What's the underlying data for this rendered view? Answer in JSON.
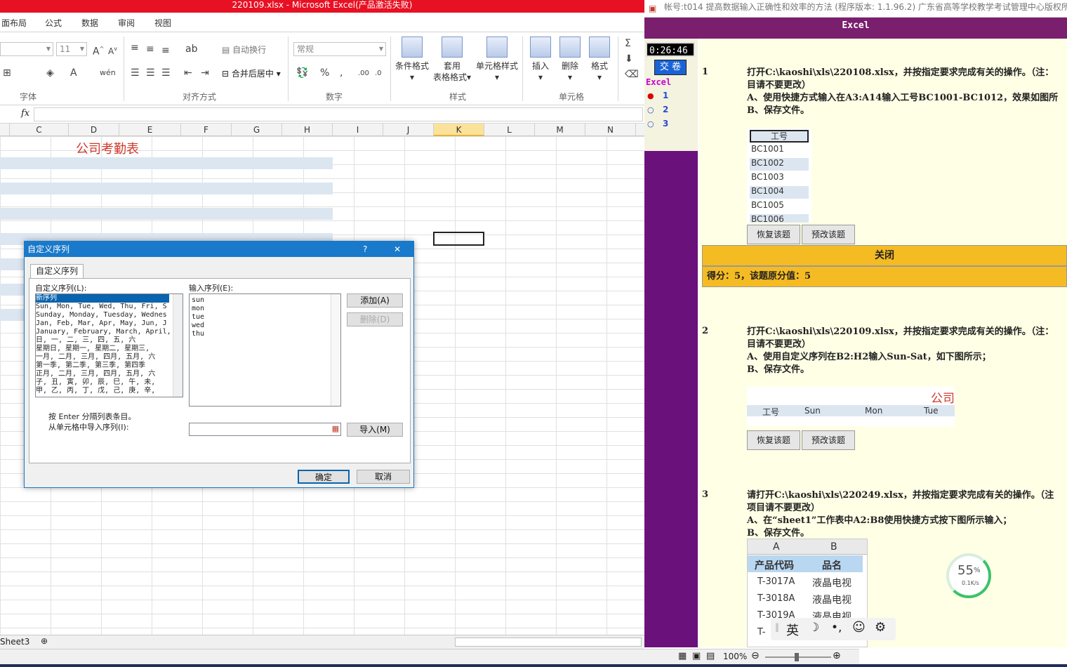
{
  "excel": {
    "title": "220109.xlsx  -  Microsoft Excel(产品激活失败)",
    "tabs": [
      "面布局",
      "公式",
      "数据",
      "审阅",
      "视图"
    ],
    "font_size": "11",
    "ribbon": {
      "wrap_text": "自动换行",
      "merge_center": "合并后居中",
      "number_format": "常规",
      "cond_format": "条件格式",
      "table_format_1": "套用",
      "table_format_2": "表格格式",
      "cell_style": "单元格样式",
      "insert": "插入",
      "delete": "删除",
      "format": "格式",
      "groups": {
        "font": "字体",
        "align": "对齐方式",
        "number": "数字",
        "styles": "样式",
        "cells": "单元格"
      }
    },
    "fx": "fx",
    "columns": [
      "C",
      "D",
      "E",
      "F",
      "G",
      "H",
      "I",
      "J",
      "K",
      "L",
      "M",
      "N"
    ],
    "active_column": "K",
    "sheet_title": "公司考勤表",
    "sheet_tab": "Sheet3",
    "zoom": "100%"
  },
  "dialog": {
    "title": "自定义序列",
    "help": "?",
    "close": "✕",
    "tab": "自定义序列",
    "list_label": "自定义序列(L):",
    "input_label": "输入序列(E):",
    "lists": [
      "新序列",
      "Sun, Mon, Tue, Wed, Thu, Fri, S",
      "Sunday, Monday, Tuesday, Wednes",
      "Jan, Feb, Mar, Apr, May, Jun, J",
      "January, February, March, April,",
      "日, 一, 二, 三, 四, 五, 六",
      "星期日, 星期一, 星期二, 星期三,",
      "一月, 二月, 三月, 四月, 五月, 六",
      "第一季, 第二季, 第三季, 第四季",
      "正月, 二月, 三月, 四月, 五月, 六",
      "子, 丑, 寅, 卯, 辰, 巳, 午, 未,",
      "甲, 乙, 丙, 丁, 戊, 己, 庚, 辛,"
    ],
    "entries": [
      "sun",
      "mon",
      "tue",
      "wed",
      "thu"
    ],
    "add": "添加(A)",
    "delete": "删除(D)",
    "hint": "按 Enter 分隔列表条目。",
    "import_label": "从单元格中导入序列(I):",
    "import_btn": "导入(M)",
    "ok": "确定",
    "cancel": "取消"
  },
  "exam": {
    "title": "帐号:t014  提高数据输入正确性和效率的方法 (程序版本: 1.1.96.2) 广东省高等学校教学考试管理中心版权所有",
    "header": "Excel",
    "timer": "0:26:46",
    "submit": "交 卷",
    "category": "Excel",
    "nav": [
      "1",
      "2",
      "3"
    ],
    "questions": [
      {
        "num": "1",
        "lines": [
          "打开C:\\kaoshi\\xls\\220108.xlsx，并按指定要求完成有关的操作。（注：",
          "目请不要更改）",
          "A、使用快捷方式输入在A3:A14输入工号BC1001-BC1012，效果如图所",
          "B、保存文件。"
        ]
      },
      {
        "num": "2",
        "lines": [
          "打开C:\\kaoshi\\xls\\220109.xlsx，并按指定要求完成有关的操作。（注：",
          "目请不要更改）",
          "A、使用自定义序列在B2:H2输入Sun-Sat，如下图所示；",
          "B、保存文件。"
        ]
      },
      {
        "num": "3",
        "lines": [
          "请打开C:\\kaoshi\\xls\\220249.xlsx，并按指定要求完成有关的操作。（注",
          "项目请不要更改）",
          "A、在“sheet1”工作表中A2:B8使用快捷方式按下图所示输入；",
          "B、保存文件。"
        ]
      }
    ],
    "q1_sample": {
      "header": "工号",
      "items": [
        "BC1001",
        "BC1002",
        "BC1003",
        "BC1004",
        "BC1005",
        "BC1006"
      ]
    },
    "q2_sample": {
      "title": "公司",
      "cols": [
        "工号",
        "Sun",
        "Mon",
        "Tue"
      ]
    },
    "q3_sample": {
      "cols": [
        "A",
        "B"
      ],
      "head": [
        "产品代码",
        "品名"
      ],
      "rows": [
        [
          "T-3017A",
          "液晶电视"
        ],
        [
          "T-3018A",
          "液晶电视"
        ],
        [
          "T-3019A",
          "液晶电视"
        ],
        [
          "T-",
          ""
        ]
      ]
    },
    "restore": "恢复该题",
    "preview": "预改该题",
    "close": "关闭",
    "score": "得分：5，该题原分值：5"
  },
  "netmeter": {
    "percent": "55",
    "unit": "%",
    "speed": "0.1K/s"
  },
  "ime": {
    "lang": "英"
  }
}
